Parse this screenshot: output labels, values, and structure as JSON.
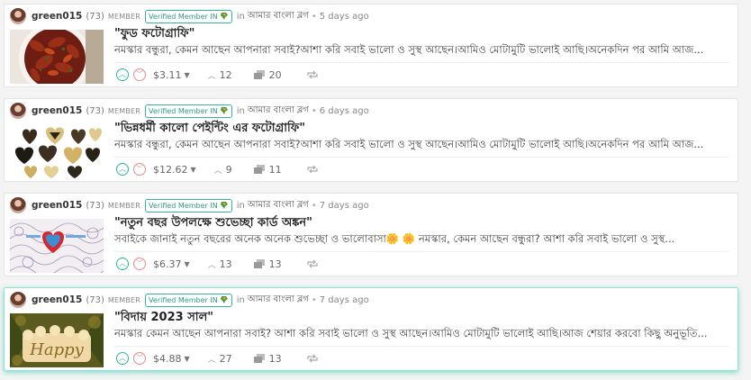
{
  "posts": [
    {
      "author": "green015",
      "reputation": "(73)",
      "member_label": "MEMBER",
      "badge": "Verified Member IN",
      "in_label": "in",
      "community": "আমার বাংলা ব্লগ",
      "time": "5 days ago",
      "title": "\"ফুড ফটোগ্রাফি\"",
      "body": "নমস্কার বন্ধুরা, কেমন আছেন আপনারা সবাই?আশা করি সবাই ভালো ও সুস্থ আছেন।আমিও মোটামুটি ভালোই আছি।অনেকদিন পর আমি আজ...",
      "payout": "$3.11",
      "votes": "12",
      "comments": "20",
      "thumb_icon": "food-photo-thumbnail"
    },
    {
      "author": "green015",
      "reputation": "(73)",
      "member_label": "MEMBER",
      "badge": "Verified Member IN",
      "in_label": "in",
      "community": "আমার বাংলা ব্লগ",
      "time": "6 days ago",
      "title": "\"ভিন্নধর্মী কালো পেইন্টিং এর ফটোগ্রাফি\"",
      "body": "নমস্কার বন্ধুরা, কেমন আছেন আপনারা সবাই?আশা করি সবাই ভালো ও সুস্থ আছেন।আমিও মোটামুটি ভালোই আছি।অনেকদিন পর আমি আজ...",
      "payout": "$12.62",
      "votes": "9",
      "comments": "11",
      "thumb_icon": "heart-paintings-thumbnail"
    },
    {
      "author": "green015",
      "reputation": "(73)",
      "member_label": "MEMBER",
      "badge": "Verified Member IN",
      "in_label": "in",
      "community": "আমার বাংলা ব্লগ",
      "time": "7 days ago",
      "title": "\"নতুন বছর উপলক্ষে শুভেচ্ছা কার্ড অঙ্কন\"",
      "body": "সবাইকে জানাই নতুন বছরের অনেক অনেক শুভেচ্ছা ও ভালোবাসা🌼 🌼 নমস্কার, কেমন আছেন বন্ধুরা? আশা করি সবাই ভালো ও সুস্থ...",
      "payout": "$6.37",
      "votes": "13",
      "comments": "13",
      "thumb_icon": "greeting-card-thumbnail"
    },
    {
      "author": "green015",
      "reputation": "(73)",
      "member_label": "MEMBER",
      "badge": "Verified Member IN",
      "in_label": "in",
      "community": "আমার বাংলা ব্লগ",
      "time": "7 days ago",
      "title": "\"বিদায় 2023 সাল\"",
      "body": "নমস্কার কেমন আছেন আপনারা সবাই? আশা করি সবাই ভালো ও সুস্থ আছেন।আমিও মোটামুটি ভালোই আছি।আজ শেয়ার করবো কিছু অনুভূতি...",
      "payout": "$4.88",
      "votes": "27",
      "comments": "13",
      "thumb_icon": "happy-sign-thumbnail",
      "thumb_text": "Happy"
    }
  ]
}
